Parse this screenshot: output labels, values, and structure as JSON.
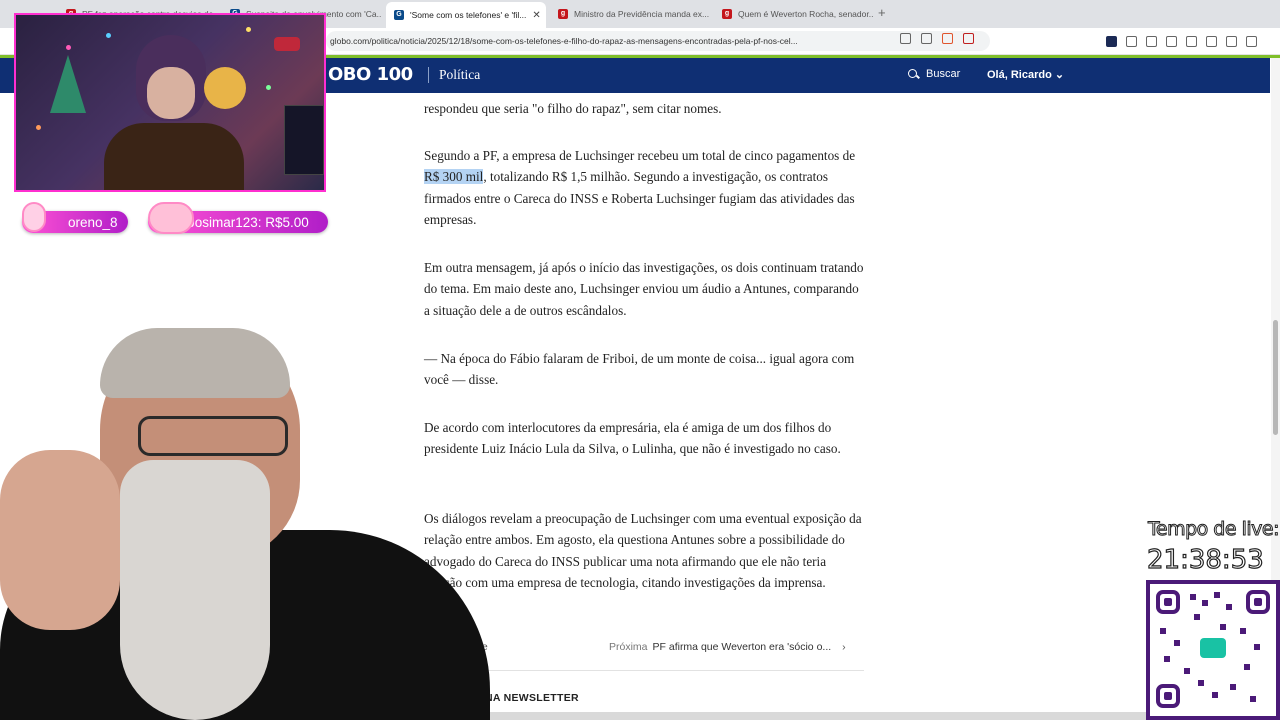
{
  "browser": {
    "tabs": [
      {
        "label": "PF faz operação contra desvios de..."
      },
      {
        "label": "Suspeita de envolvimento com 'Ca..."
      },
      {
        "label": "'Some com os telefones' e 'fil..."
      },
      {
        "label": "Ministro da Previdência manda ex..."
      },
      {
        "label": "Quem é Weverton Rocha, senador..."
      }
    ],
    "new_tab": "+",
    "url": "globo.com/politica/noticia/2025/12/18/some-com-os-telefones-e-filho-do-rapaz-as-mensagens-encontradas-pela-pf-nos-cel..."
  },
  "site": {
    "logo": "OBO 100",
    "section": "Política",
    "search_label": "Buscar",
    "user_label": "Olá, Ricardo"
  },
  "article": {
    "p0": "respondeu que seria \"o filho do rapaz\", sem citar nomes.",
    "p1_a": "Segundo a PF, a empresa de Luchsinger recebeu um total de cinco pagamentos de ",
    "p1_hl": "R$ 300 mil",
    "p1_b": ", totalizando R$ 1,5 milhão. Segundo a investigação, os contratos firmados entre o Careca do INSS e Roberta Luchsinger fugiam das atividades das empresas.",
    "p2": "Em outra mensagem, já após o início das investigações, os dois continuam tratando do tema. Em maio deste ano, Luchsinger enviou um áudio a Antunes, comparando a situação dele a de outros escândalos.",
    "p3": "— Na época do Fábio falaram de Friboi, de um monte de coisa... igual agora com você — disse.",
    "p4": "De acordo com interlocutores da empresária, ela é amiga de um dos filhos do presidente Luiz Inácio Lula da Silva, o Lulinha, que não é investigado no caso.",
    "p5": "Os diálogos revelam a preocupação de Luchsinger com uma eventual exposição da relação entre ambos. Em agosto, ela questiona Antunes sobre a possibilidade do advogado do Careca do INSS publicar uma nota afirmando que ele não teria ligação com uma empresa de tecnologia, citando investigações da imprensa.",
    "nav_prev": "cente",
    "nav_next_label": "Próxima",
    "nav_next_title": "PF afirma que Weverton era 'sócio o...",
    "newsletter": "NA NEWSLETTER"
  },
  "stream": {
    "donor1": "oreno_8",
    "donor2": "Josimar123: R$5.00",
    "timer_label": "Tempo de live:",
    "timer_value": "21:38:53"
  },
  "colors": {
    "site_header": "#0f2f73",
    "accent_bar": "#7fbf2a",
    "pill": "#e33cd6",
    "selection": "#b4d3f3"
  }
}
